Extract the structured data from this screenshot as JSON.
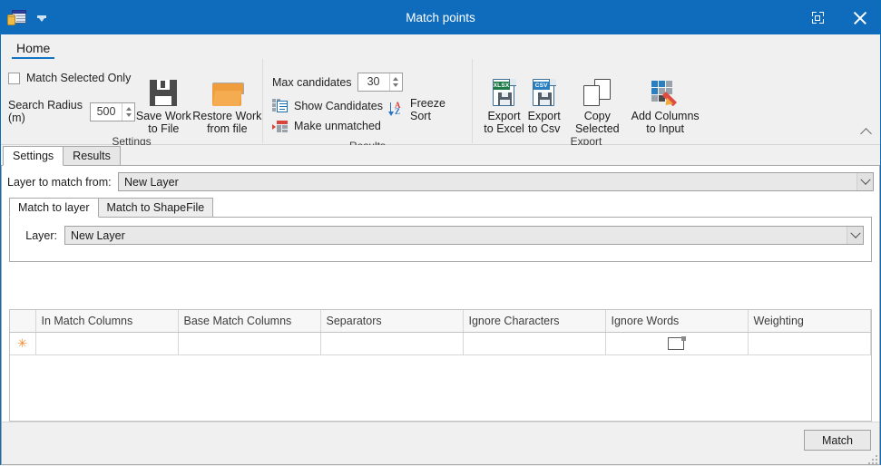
{
  "window": {
    "title": "Match points",
    "app_icon": "table-database-icon",
    "caret_icon": "quick-access-dropdown-icon",
    "restore_label": "restore-icon",
    "close_label": "close-icon"
  },
  "ribbon": {
    "tabs": [
      {
        "label": "Home",
        "active": true
      }
    ],
    "collapse_icon": "chevron-up-icon",
    "groups": [
      {
        "name": "Settings",
        "label": "Settings",
        "checkbox": {
          "label": "Match Selected Only",
          "checked": false
        },
        "radius": {
          "label": "Search Radius (m)",
          "value": "500"
        },
        "buttons": [
          {
            "label_line1": "Save Work",
            "label_line2": "to File",
            "icon": "floppy-disk-icon"
          },
          {
            "label_line1": "Restore Work",
            "label_line2": "from file",
            "icon": "open-folder-icon"
          }
        ]
      },
      {
        "name": "Results",
        "label": "Results",
        "max_candidates": {
          "label": "Max candidates",
          "value": "30"
        },
        "commands": [
          {
            "label": "Show Candidates",
            "icon": "show-candidates-icon"
          },
          {
            "label": "Make unmatched",
            "icon": "make-unmatched-icon"
          }
        ],
        "freeze_sort": {
          "label": "Freeze Sort",
          "icon": "sort-az-icon"
        }
      },
      {
        "name": "Export",
        "label": "Export",
        "buttons": [
          {
            "label_line1": "Export",
            "label_line2": "to Excel",
            "icon": "export-xlsx-icon",
            "badge": "XLSX",
            "badge_color": "#1e7a49"
          },
          {
            "label_line1": "Export",
            "label_line2": "to Csv",
            "icon": "export-csv-icon",
            "badge": "CSV",
            "badge_color": "#2a7fc1"
          },
          {
            "label_line1": "Copy Selected",
            "label_line2": "",
            "icon": "copy-pages-icon"
          },
          {
            "label_line1": "Add Columns",
            "label_line2": "to Input",
            "icon": "add-columns-icon"
          }
        ]
      }
    ]
  },
  "main": {
    "tabs": [
      {
        "label": "Settings",
        "active": true
      },
      {
        "label": "Results",
        "active": false
      }
    ],
    "layer_from": {
      "label": "Layer to match from:",
      "value": "New Layer",
      "arrow_icon": "chevron-down-icon"
    },
    "inner_tabs": [
      {
        "label": "Match to layer",
        "active": true
      },
      {
        "label": "Match to ShapeFile",
        "active": false
      }
    ],
    "layer": {
      "label": "Layer:",
      "value": "New Layer",
      "arrow_icon": "chevron-down-icon"
    },
    "grid": {
      "columns": [
        "In Match Columns",
        "Base Match Columns",
        "Separators",
        "Ignore Characters",
        "Ignore Words",
        "Weighting"
      ],
      "rows": [
        {
          "row_indicator": "new-row-star",
          "cells": [
            "",
            "",
            "",
            "",
            "",
            ""
          ],
          "ignore_words_icon": "page-icon"
        }
      ]
    },
    "match_button": "Match",
    "resize_grip": "resize-grip-icon"
  },
  "colors": {
    "titlebar": "#0f6cbd",
    "accent": "#1273c7",
    "ribbon_bg": "#f0f0f0",
    "new_row_star": "#f08a28",
    "folder_orange": "#ef9d3c"
  }
}
